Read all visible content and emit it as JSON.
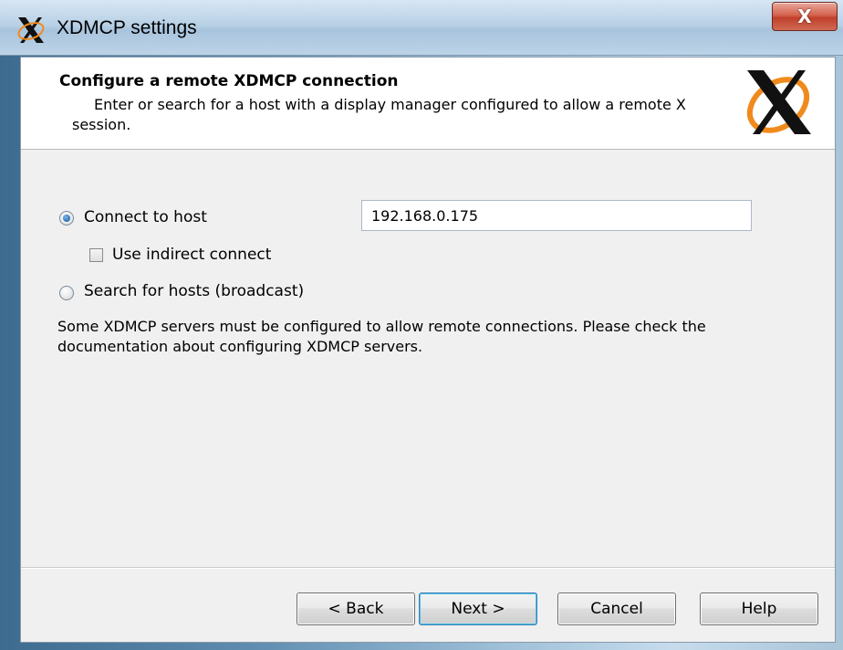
{
  "window": {
    "title": "XDMCP settings",
    "close_label": "X"
  },
  "header": {
    "title": "Configure a remote XDMCP connection",
    "description_line1": "Enter or search for a host with a display manager configured to allow a remote X",
    "description_line2": "session."
  },
  "options": {
    "connect_to_host": {
      "label": "Connect to host",
      "checked": true
    },
    "host_value": "192.168.0.175",
    "use_indirect": {
      "label": "Use indirect connect",
      "checked": false
    },
    "search_hosts": {
      "label": "Search for hosts (broadcast)",
      "checked": false
    }
  },
  "info_text": "Some XDMCP servers must be configured to allow remote connections. Please check the documentation about configuring XDMCP servers.",
  "buttons": {
    "back": "< Back",
    "next": "Next >",
    "cancel": "Cancel",
    "help": "Help"
  },
  "icons": {
    "title": "x-logo-icon",
    "header": "x-logo-icon",
    "close": "close-icon"
  },
  "colors": {
    "logo_orange": "#f08a1c",
    "logo_black": "#111111"
  }
}
